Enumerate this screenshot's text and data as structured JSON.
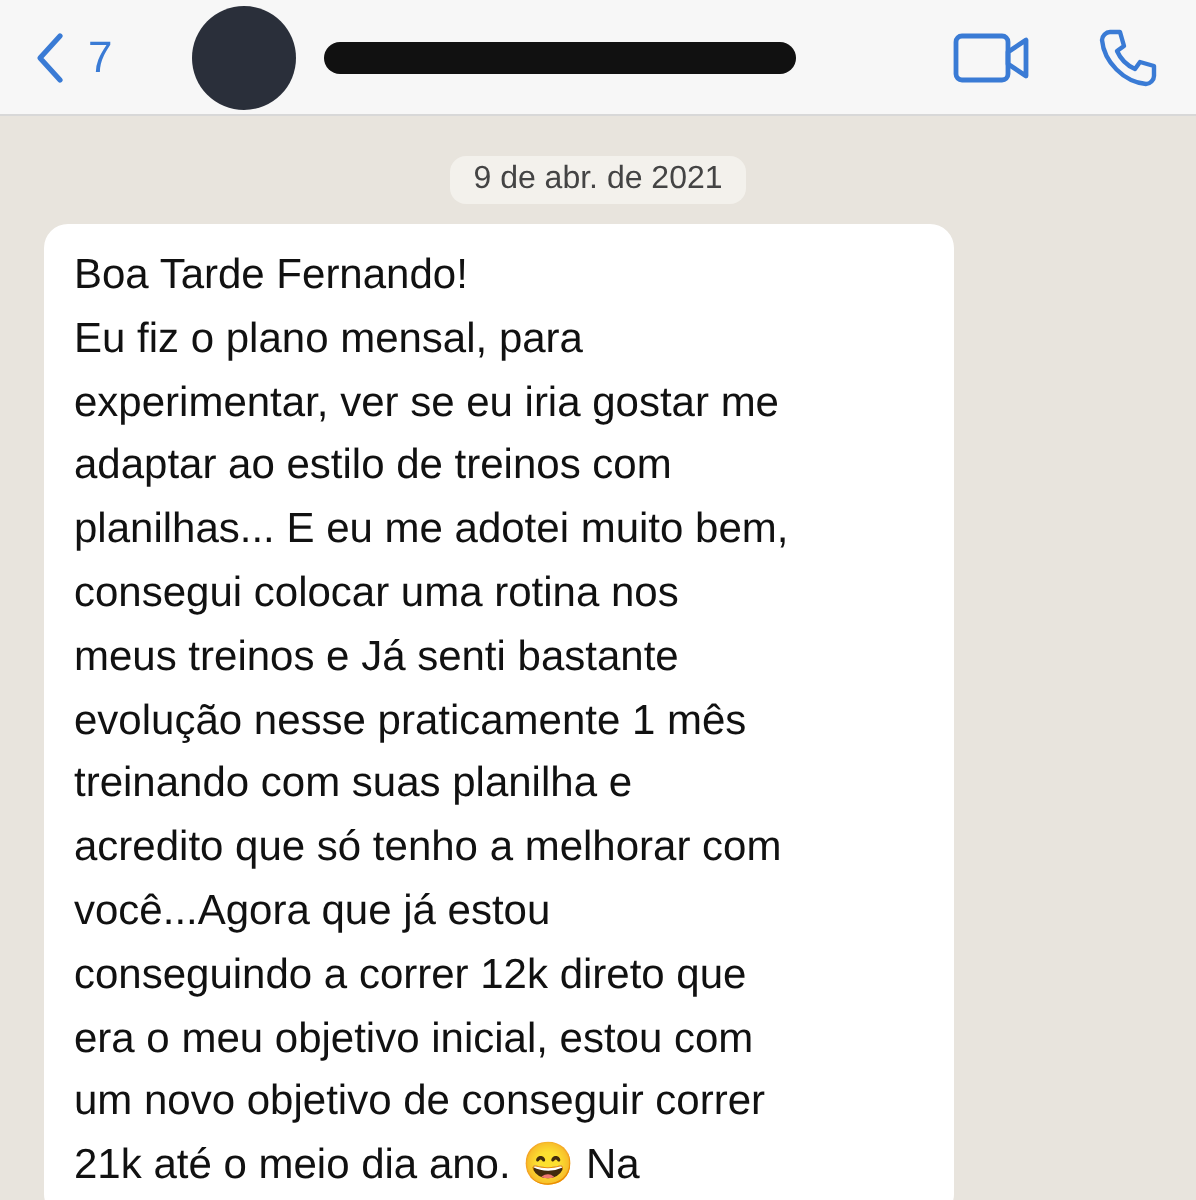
{
  "header": {
    "back_count": "7"
  },
  "date_label": "9 de abr. de 2021",
  "message": {
    "text": "Boa Tarde Fernando!\nEu fiz o plano mensal, para\nexperimentar, ver se eu iria gostar me\nadaptar ao estilo de treinos com\nplanilhas... E eu me adotei muito bem,\nconsegui colocar uma rotina nos\nmeus treinos e Já senti bastante\nevolução nesse praticamente 1 mês\ntreinando com suas planilha e\nacredito que só tenho a melhorar com\nvocê...Agora que já estou\nconseguindo a correr 12k direto que\nera o meu objetivo inicial, estou com\num novo objetivo de conseguir correr\n21k até o meio dia ano. 😄 Na"
  }
}
